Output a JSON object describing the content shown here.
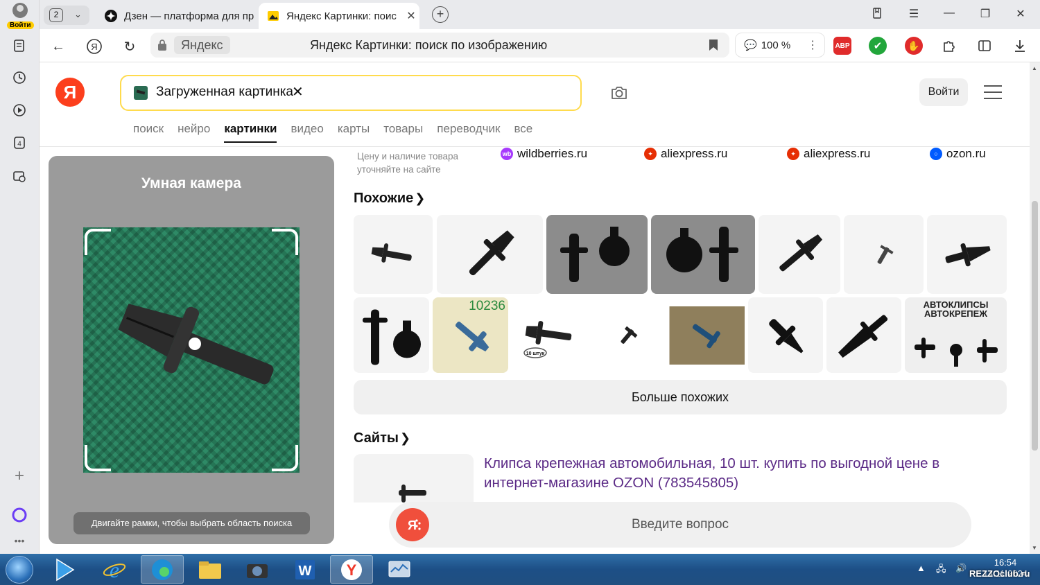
{
  "browser": {
    "sidebar": {
      "login_badge": "Войти",
      "notifications_count": "4"
    },
    "tabs": [
      {
        "title": "Дзен — платформа для пр",
        "active": false
      },
      {
        "title": "Яндекс Картинки: поис",
        "active": true
      }
    ],
    "tab_count": "2",
    "address": {
      "domain": "Яндекс",
      "page_title": "Яндекс Картинки: поиск по изображению",
      "zoom": "100 %"
    },
    "extensions": {
      "abp_label": "ABP"
    }
  },
  "header": {
    "logo_letter": "Я",
    "search_chip": "Загруженная картинка",
    "login_button": "Войти",
    "services": [
      {
        "label": "поиск",
        "active": false
      },
      {
        "label": "нейро",
        "active": false
      },
      {
        "label": "картинки",
        "active": true
      },
      {
        "label": "видео",
        "active": false
      },
      {
        "label": "карты",
        "active": false
      },
      {
        "label": "товары",
        "active": false
      },
      {
        "label": "переводчик",
        "active": false
      },
      {
        "label": "все",
        "active": false
      }
    ]
  },
  "smart_camera": {
    "title": "Умная камера",
    "hint": "Двигайте рамки, чтобы выбрать область поиска"
  },
  "shops": {
    "price_note": "Цену и наличие товара уточняйте на сайте",
    "items": [
      {
        "name": "wildberries.ru",
        "icon": "wildberries-icon",
        "color": "#a73afd"
      },
      {
        "name": "aliexpress.ru",
        "icon": "aliexpress-icon",
        "color": "#e62e04"
      },
      {
        "name": "aliexpress.ru",
        "icon": "aliexpress-icon",
        "color": "#e62e04"
      },
      {
        "name": "ozon.ru",
        "icon": "ozon-icon",
        "color": "#005bff"
      }
    ]
  },
  "similar": {
    "title": "Похожие",
    "more_button": "Больше похожих",
    "thumb_badge": "10236",
    "thumb_pack_label": "10 штук",
    "thumb_banner": "АВТОКЛИПСЫ АВТОКРЕПЕЖ"
  },
  "sites": {
    "title": "Сайты",
    "first_result": "Клипса крепежная автомобильная, 10 шт. купить по выгодной цене в интернет-магазине OZON (783545805)"
  },
  "alice": {
    "placeholder": "Введите вопрос"
  },
  "taskbar": {
    "time": "16:54",
    "date": "14.11.2024",
    "watermark": "REZZOclub.ru"
  }
}
